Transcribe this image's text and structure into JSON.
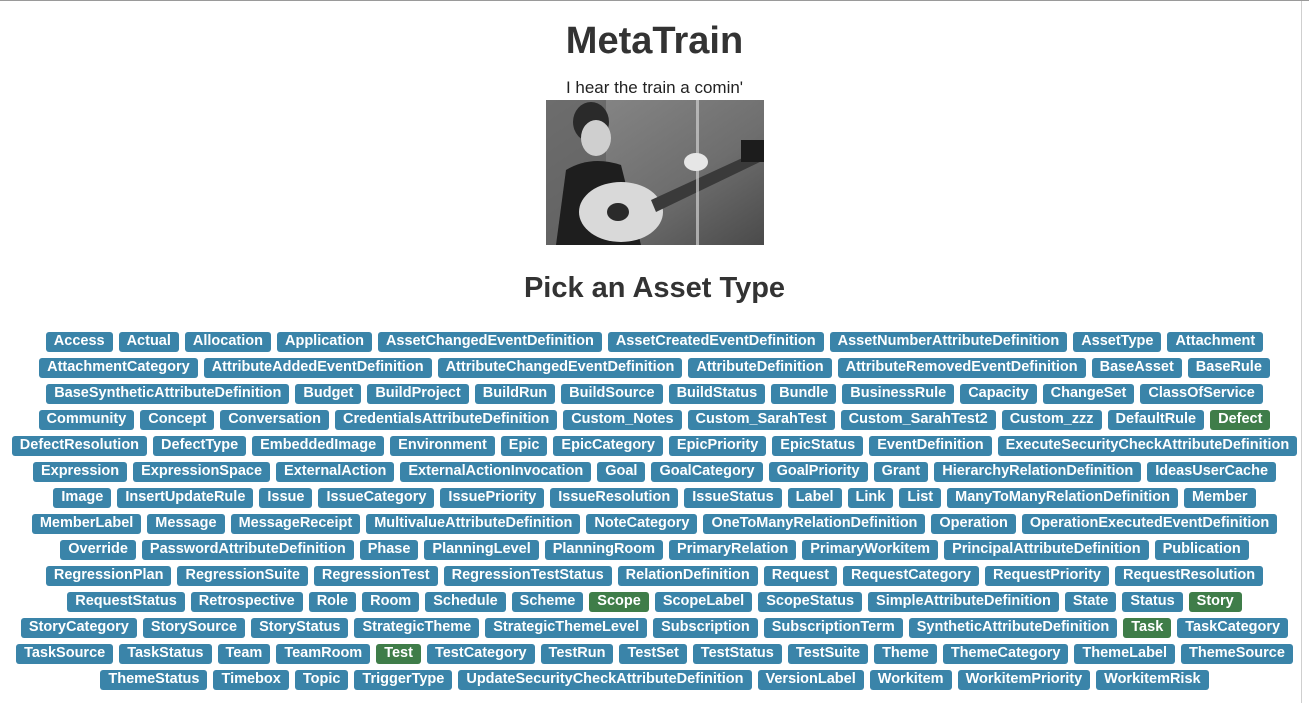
{
  "header": {
    "title": "MetaTrain",
    "subtitle": "I hear the train a comin'"
  },
  "photo": {
    "description": "black and white photo of a man playing an acoustic guitar"
  },
  "section": {
    "title": "Pick an Asset Type"
  },
  "colors": {
    "badge": "#3a84a9",
    "badge_active": "#3f7d49"
  },
  "asset_types": [
    {
      "label": "Access"
    },
    {
      "label": "Actual"
    },
    {
      "label": "Allocation"
    },
    {
      "label": "Application"
    },
    {
      "label": "AssetChangedEventDefinition"
    },
    {
      "label": "AssetCreatedEventDefinition"
    },
    {
      "label": "AssetNumberAttributeDefinition"
    },
    {
      "label": "AssetType"
    },
    {
      "label": "Attachment"
    },
    {
      "label": "AttachmentCategory"
    },
    {
      "label": "AttributeAddedEventDefinition"
    },
    {
      "label": "AttributeChangedEventDefinition"
    },
    {
      "label": "AttributeDefinition"
    },
    {
      "label": "AttributeRemovedEventDefinition"
    },
    {
      "label": "BaseAsset"
    },
    {
      "label": "BaseRule"
    },
    {
      "label": "BaseSyntheticAttributeDefinition"
    },
    {
      "label": "Budget"
    },
    {
      "label": "BuildProject"
    },
    {
      "label": "BuildRun"
    },
    {
      "label": "BuildSource"
    },
    {
      "label": "BuildStatus"
    },
    {
      "label": "Bundle"
    },
    {
      "label": "BusinessRule"
    },
    {
      "label": "Capacity"
    },
    {
      "label": "ChangeSet"
    },
    {
      "label": "ClassOfService"
    },
    {
      "label": "Community"
    },
    {
      "label": "Concept"
    },
    {
      "label": "Conversation"
    },
    {
      "label": "CredentialsAttributeDefinition"
    },
    {
      "label": "Custom_Notes"
    },
    {
      "label": "Custom_SarahTest"
    },
    {
      "label": "Custom_SarahTest2"
    },
    {
      "label": "Custom_zzz"
    },
    {
      "label": "DefaultRule"
    },
    {
      "label": "Defect",
      "active": true
    },
    {
      "label": "DefectResolution"
    },
    {
      "label": "DefectType"
    },
    {
      "label": "EmbeddedImage"
    },
    {
      "label": "Environment"
    },
    {
      "label": "Epic"
    },
    {
      "label": "EpicCategory"
    },
    {
      "label": "EpicPriority"
    },
    {
      "label": "EpicStatus"
    },
    {
      "label": "EventDefinition"
    },
    {
      "label": "ExecuteSecurityCheckAttributeDefinition"
    },
    {
      "label": "Expression"
    },
    {
      "label": "ExpressionSpace"
    },
    {
      "label": "ExternalAction"
    },
    {
      "label": "ExternalActionInvocation"
    },
    {
      "label": "Goal"
    },
    {
      "label": "GoalCategory"
    },
    {
      "label": "GoalPriority"
    },
    {
      "label": "Grant"
    },
    {
      "label": "HierarchyRelationDefinition"
    },
    {
      "label": "IdeasUserCache"
    },
    {
      "label": "Image"
    },
    {
      "label": "InsertUpdateRule"
    },
    {
      "label": "Issue"
    },
    {
      "label": "IssueCategory"
    },
    {
      "label": "IssuePriority"
    },
    {
      "label": "IssueResolution"
    },
    {
      "label": "IssueStatus"
    },
    {
      "label": "Label"
    },
    {
      "label": "Link"
    },
    {
      "label": "List"
    },
    {
      "label": "ManyToManyRelationDefinition"
    },
    {
      "label": "Member"
    },
    {
      "label": "MemberLabel"
    },
    {
      "label": "Message"
    },
    {
      "label": "MessageReceipt"
    },
    {
      "label": "MultivalueAttributeDefinition"
    },
    {
      "label": "NoteCategory"
    },
    {
      "label": "OneToManyRelationDefinition"
    },
    {
      "label": "Operation"
    },
    {
      "label": "OperationExecutedEventDefinition"
    },
    {
      "label": "Override"
    },
    {
      "label": "PasswordAttributeDefinition"
    },
    {
      "label": "Phase"
    },
    {
      "label": "PlanningLevel"
    },
    {
      "label": "PlanningRoom"
    },
    {
      "label": "PrimaryRelation"
    },
    {
      "label": "PrimaryWorkitem"
    },
    {
      "label": "PrincipalAttributeDefinition"
    },
    {
      "label": "Publication"
    },
    {
      "label": "RegressionPlan"
    },
    {
      "label": "RegressionSuite"
    },
    {
      "label": "RegressionTest"
    },
    {
      "label": "RegressionTestStatus"
    },
    {
      "label": "RelationDefinition"
    },
    {
      "label": "Request"
    },
    {
      "label": "RequestCategory"
    },
    {
      "label": "RequestPriority"
    },
    {
      "label": "RequestResolution"
    },
    {
      "label": "RequestStatus"
    },
    {
      "label": "Retrospective"
    },
    {
      "label": "Role"
    },
    {
      "label": "Room"
    },
    {
      "label": "Schedule"
    },
    {
      "label": "Scheme"
    },
    {
      "label": "Scope",
      "active": true
    },
    {
      "label": "ScopeLabel"
    },
    {
      "label": "ScopeStatus"
    },
    {
      "label": "SimpleAttributeDefinition"
    },
    {
      "label": "State"
    },
    {
      "label": "Status"
    },
    {
      "label": "Story",
      "active": true
    },
    {
      "label": "StoryCategory"
    },
    {
      "label": "StorySource"
    },
    {
      "label": "StoryStatus"
    },
    {
      "label": "StrategicTheme"
    },
    {
      "label": "StrategicThemeLevel"
    },
    {
      "label": "Subscription"
    },
    {
      "label": "SubscriptionTerm"
    },
    {
      "label": "SyntheticAttributeDefinition"
    },
    {
      "label": "Task",
      "active": true
    },
    {
      "label": "TaskCategory"
    },
    {
      "label": "TaskSource"
    },
    {
      "label": "TaskStatus"
    },
    {
      "label": "Team"
    },
    {
      "label": "TeamRoom"
    },
    {
      "label": "Test",
      "active": true
    },
    {
      "label": "TestCategory"
    },
    {
      "label": "TestRun"
    },
    {
      "label": "TestSet"
    },
    {
      "label": "TestStatus"
    },
    {
      "label": "TestSuite"
    },
    {
      "label": "Theme"
    },
    {
      "label": "ThemeCategory"
    },
    {
      "label": "ThemeLabel"
    },
    {
      "label": "ThemeSource"
    },
    {
      "label": "ThemeStatus"
    },
    {
      "label": "Timebox"
    },
    {
      "label": "Topic"
    },
    {
      "label": "TriggerType"
    },
    {
      "label": "UpdateSecurityCheckAttributeDefinition"
    },
    {
      "label": "VersionLabel"
    },
    {
      "label": "Workitem"
    },
    {
      "label": "WorkitemPriority"
    },
    {
      "label": "WorkitemRisk"
    }
  ]
}
